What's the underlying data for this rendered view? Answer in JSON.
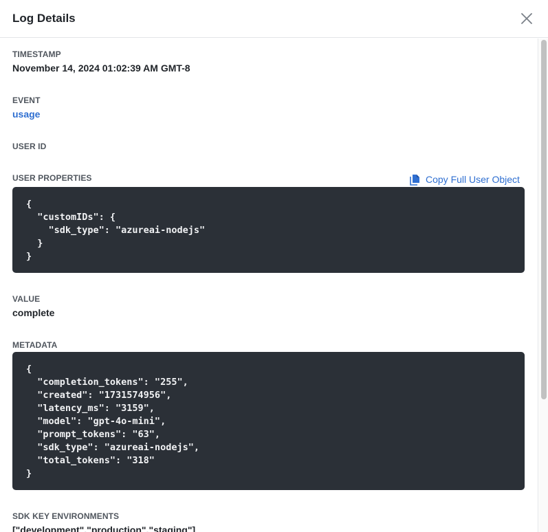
{
  "header": {
    "title": "Log Details",
    "close_icon": "close-icon"
  },
  "fields": {
    "timestamp": {
      "label": "TIMESTAMP",
      "value": "November 14, 2024 01:02:39 AM GMT-8"
    },
    "event": {
      "label": "EVENT",
      "value": "usage"
    },
    "user_id": {
      "label": "USER ID",
      "value": ""
    },
    "user_properties": {
      "label": "USER PROPERTIES",
      "copy_label": "Copy Full User Object",
      "copy_icon": "copy-icon",
      "code": "{\n  \"customIDs\": {\n    \"sdk_type\": \"azureai-nodejs\"\n  }\n}"
    },
    "value": {
      "label": "VALUE",
      "value": "complete"
    },
    "metadata": {
      "label": "METADATA",
      "code": "{\n  \"completion_tokens\": \"255\",\n  \"created\": \"1731574956\",\n  \"latency_ms\": \"3159\",\n  \"model\": \"gpt-4o-mini\",\n  \"prompt_tokens\": \"63\",\n  \"sdk_type\": \"azureai-nodejs\",\n  \"total_tokens\": \"318\"\n}"
    },
    "sdk_key_environments": {
      "label": "SDK KEY ENVIRONMENTS",
      "value": "[\"development\",\"production\",\"staging\"]"
    }
  },
  "colors": {
    "link": "#2f6fd1",
    "code_bg": "#2b3037"
  }
}
